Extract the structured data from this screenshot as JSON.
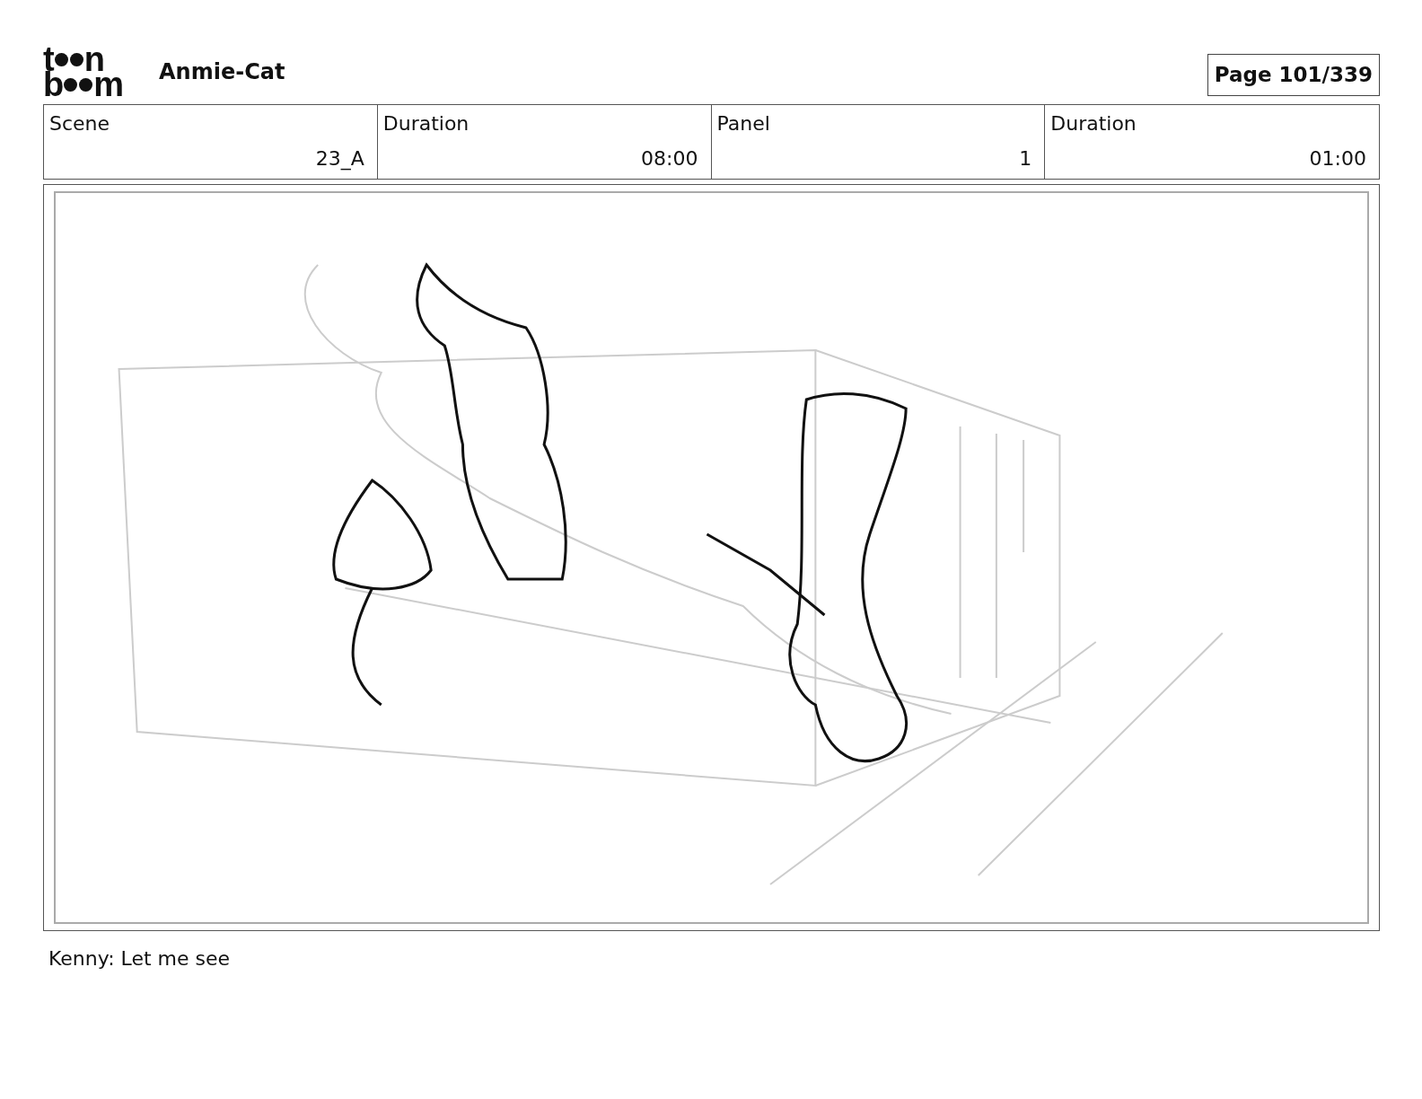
{
  "logo": {
    "top": [
      "t",
      "n"
    ],
    "bottom": [
      "b",
      "m"
    ]
  },
  "project_title": "Anmie-Cat",
  "page_label": "Page 101/339",
  "info": [
    {
      "label": "Scene",
      "value": "23_A"
    },
    {
      "label": "Duration",
      "value": "08:00"
    },
    {
      "label": "Panel",
      "value": "1"
    },
    {
      "label": "Duration",
      "value": "01:00"
    }
  ],
  "caption": "Kenny: Let me see"
}
